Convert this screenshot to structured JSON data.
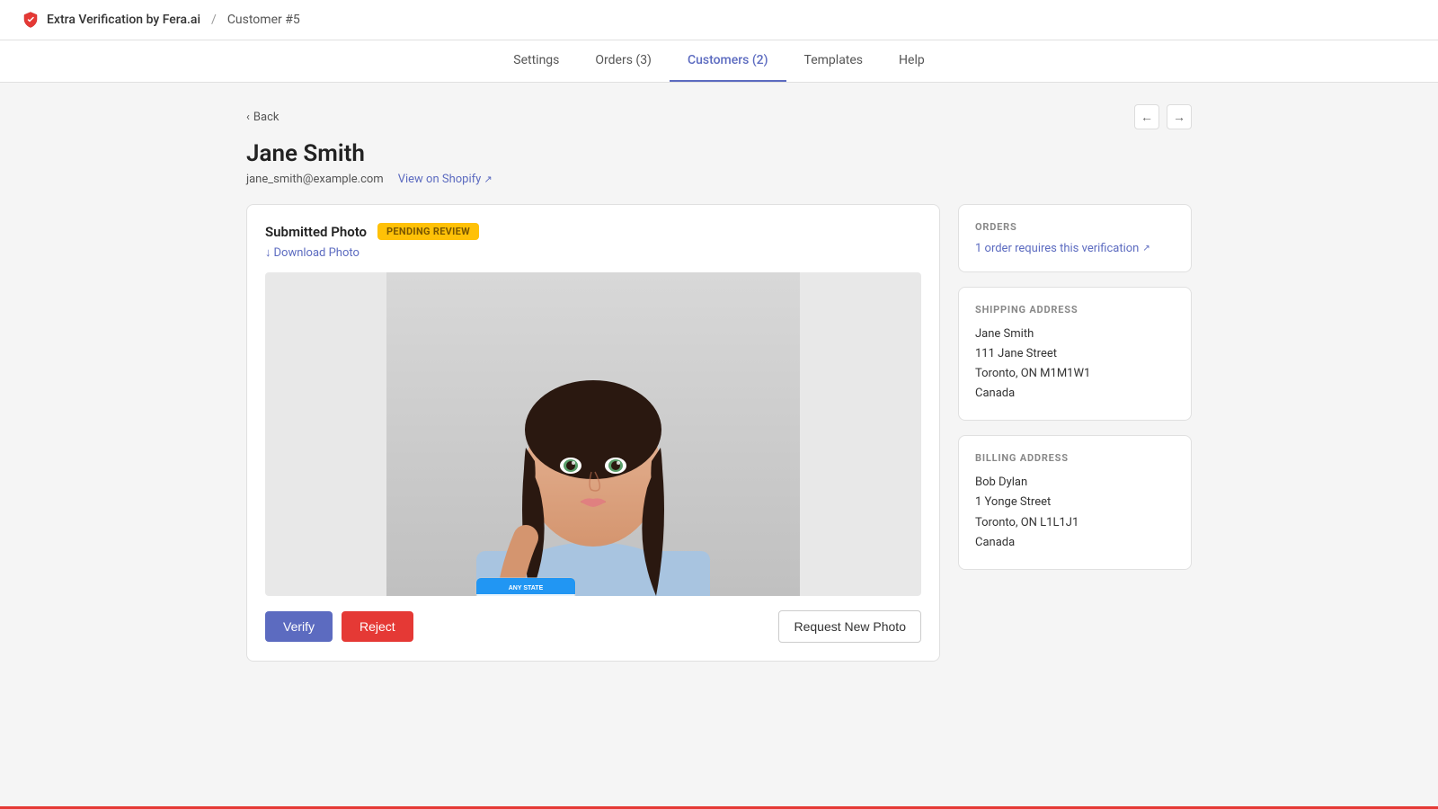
{
  "topbar": {
    "app_name": "Extra Verification by Fera.ai",
    "separator": "/",
    "page_title": "Customer #5"
  },
  "nav": {
    "items": [
      {
        "label": "Settings",
        "id": "settings",
        "active": false
      },
      {
        "label": "Orders (3)",
        "id": "orders",
        "active": false
      },
      {
        "label": "Customers (2)",
        "id": "customers",
        "active": true
      },
      {
        "label": "Templates",
        "id": "templates",
        "active": false
      },
      {
        "label": "Help",
        "id": "help",
        "active": false
      }
    ]
  },
  "back_link": "Back",
  "customer": {
    "name": "Jane Smith",
    "email": "jane_smith@example.com",
    "view_shopify": "View on Shopify"
  },
  "photo_card": {
    "label": "Submitted Photo",
    "badge": "Pending Review",
    "download_label": "Download Photo",
    "verify_label": "Verify",
    "reject_label": "Reject",
    "request_label": "Request New Photo"
  },
  "orders_section": {
    "title": "ORDERS",
    "link_text": "1 order requires this verification"
  },
  "shipping_section": {
    "title": "SHIPPING ADDRESS",
    "lines": [
      "Jane Smith",
      "111 Jane Street",
      "Toronto, ON M1M1W1",
      "Canada"
    ]
  },
  "billing_section": {
    "title": "BILLING ADDRESS",
    "lines": [
      "Bob Dylan",
      "1 Yonge Street",
      "Toronto, ON L1L1J1",
      "Canada"
    ]
  }
}
